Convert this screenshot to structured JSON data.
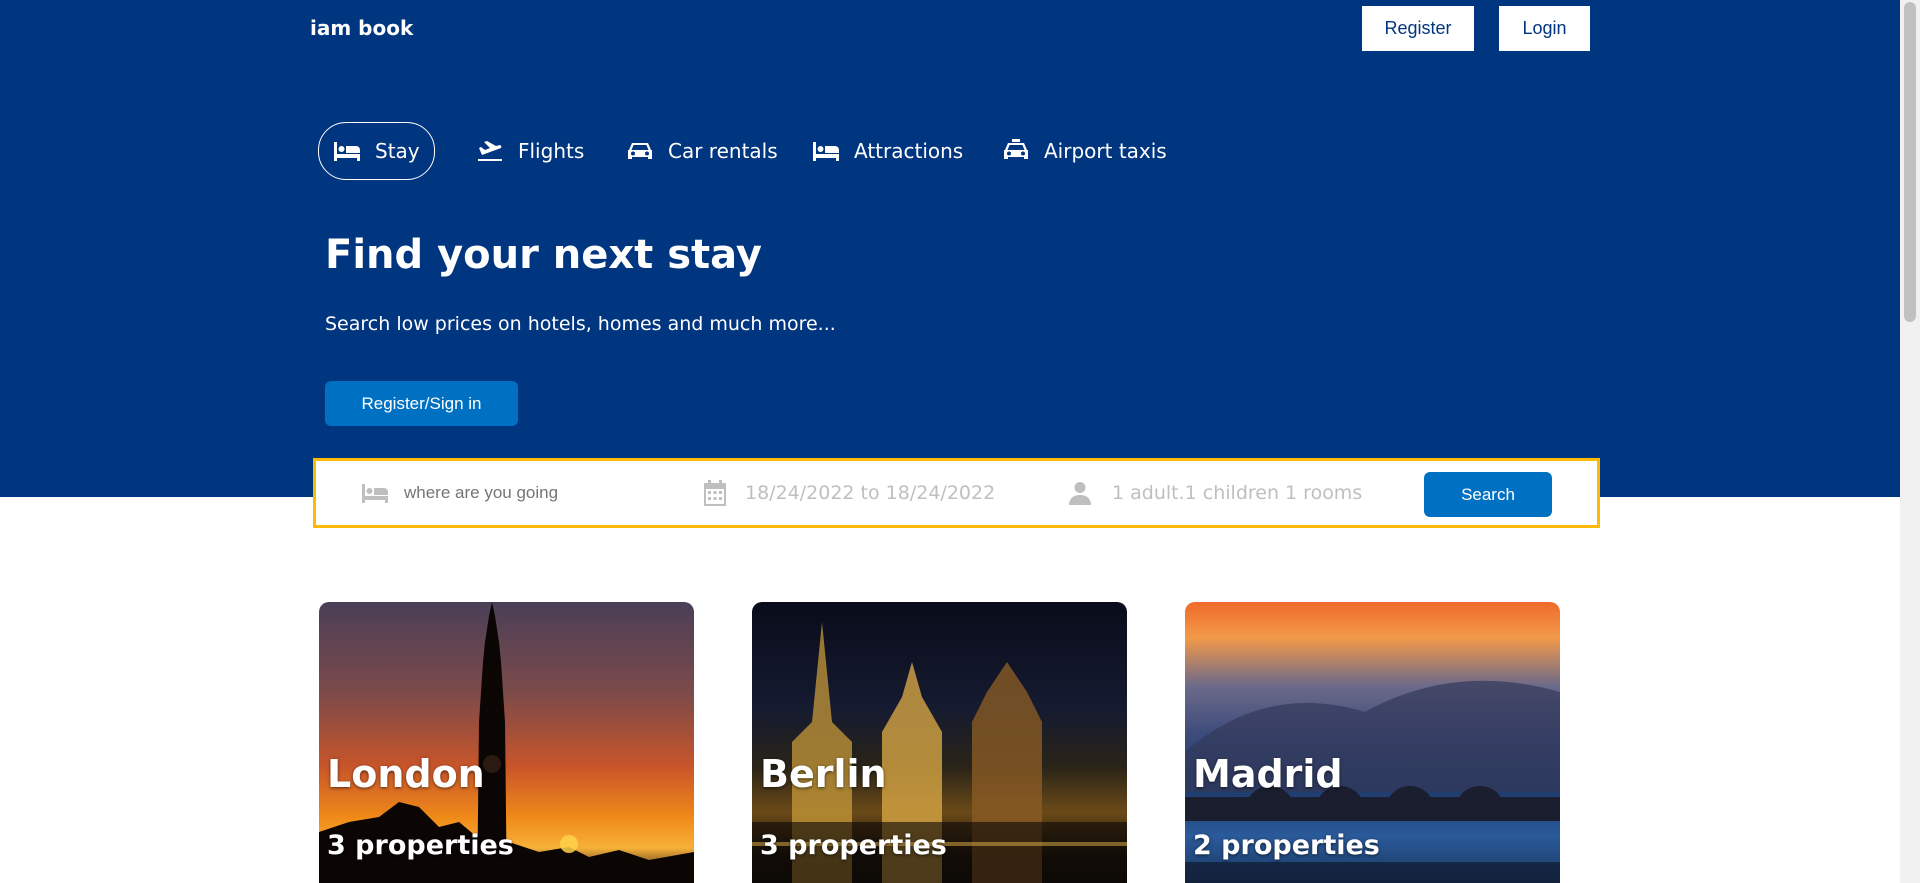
{
  "header": {
    "brand": "iam book",
    "register_label": "Register",
    "login_label": "Login"
  },
  "nav": {
    "items": [
      {
        "label": "Stay",
        "icon": "bed-icon",
        "active": true
      },
      {
        "label": "Flights",
        "icon": "plane-icon",
        "active": false
      },
      {
        "label": "Car rentals",
        "icon": "car-icon",
        "active": false
      },
      {
        "label": "Attractions",
        "icon": "bed-icon",
        "active": false
      },
      {
        "label": "Airport taxis",
        "icon": "taxi-icon",
        "active": false
      }
    ]
  },
  "hero": {
    "title": "Find your next stay",
    "subtitle": "Search low prices on hotels, homes and much more...",
    "cta_label": "Register/Sign in"
  },
  "search": {
    "destination_placeholder": "where are you going",
    "date_text": "18/24/2022 to 18/24/2022",
    "guests_text": "1 adult.1 children 1 rooms",
    "button_label": "Search"
  },
  "cities": [
    {
      "name": "London",
      "properties": "3 properties"
    },
    {
      "name": "Berlin",
      "properties": "3 properties"
    },
    {
      "name": "Madrid",
      "properties": "2 properties"
    }
  ],
  "colors": {
    "brand_blue": "#003580",
    "accent_blue": "#0071c2",
    "search_border": "#febb02"
  }
}
